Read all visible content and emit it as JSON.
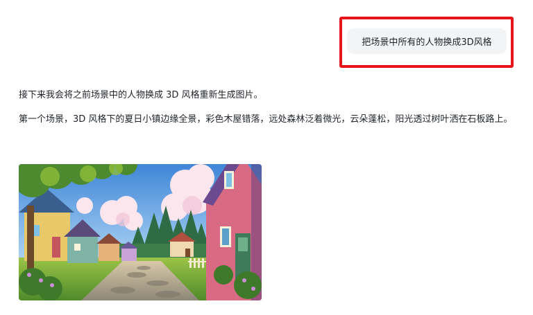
{
  "user_message": {
    "text": "把场景中所有的人物换成3D风格"
  },
  "assistant_message": {
    "paragraphs": [
      "接下来我会将之前场景中的人物换成 3D 风格重新生成图片。",
      "第一个场景，3D 风格下的夏日小镇边缘全景，彩色木屋错落，远处森林泛着微光，云朵蓬松，阳光透过树叶洒在石板路上。"
    ]
  },
  "generated_image": {
    "icon": "generated-scene-image"
  },
  "colors": {
    "highlight": "#e8141c",
    "bubble_bg": "#f3f4f6",
    "text": "#1f2329"
  }
}
